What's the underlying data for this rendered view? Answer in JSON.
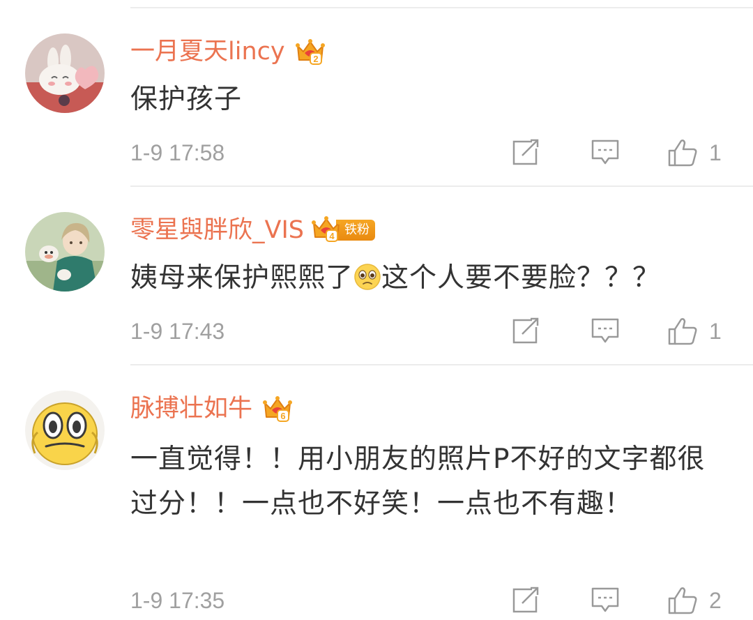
{
  "comments": [
    {
      "username": "一月夏天lincy",
      "crown_level": "2",
      "text": "保护孩子",
      "time": "1-9 17:58",
      "like_count": "1",
      "avatar": "bunny-avatar"
    },
    {
      "username": "零星與胖欣_VIS",
      "crown_level": "4",
      "fan_badge": "铁粉",
      "text_before_emoji": "姨母来保护熙熙了",
      "emoji": "pleading-face-emoji",
      "text_after_emoji": "这个人要不要脸？？？",
      "time": "1-9 17:43",
      "like_count": "1",
      "avatar": "anime-character-avatar"
    },
    {
      "username": "脉搏壮如牛",
      "crown_level": "6",
      "text": "一直觉得！！用小朋友的照片P不好的文字都很过分！！一点也不好笑！一点也不有趣！",
      "time": "1-9 17:35",
      "like_count": "2",
      "avatar": "shocked-face-avatar"
    }
  ],
  "colors": {
    "username": "#eb7350",
    "text": "#333333",
    "meta": "#a0a0a0",
    "crown": "#f5a623"
  }
}
